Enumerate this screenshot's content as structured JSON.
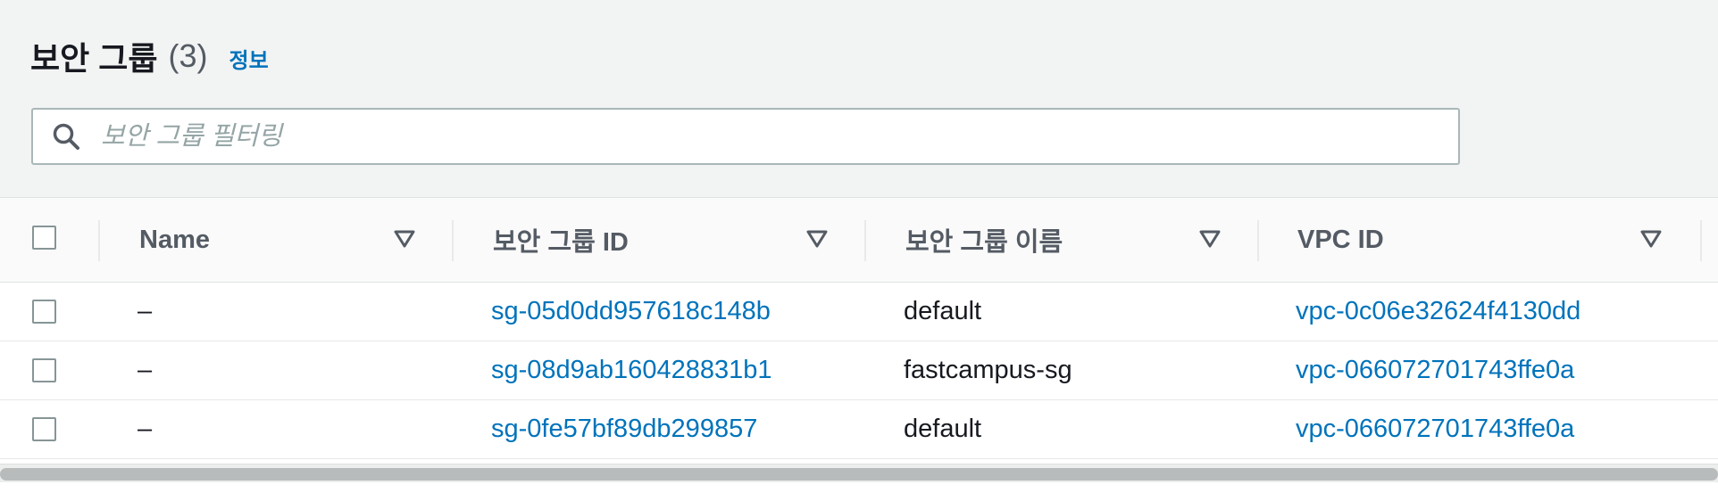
{
  "header": {
    "title": "보안 그룹",
    "count": "(3)",
    "info_link": "정보"
  },
  "search": {
    "placeholder": "보안 그룹 필터링",
    "value": ""
  },
  "table": {
    "columns": [
      {
        "label": "Name"
      },
      {
        "label": "보안 그룹 ID"
      },
      {
        "label": "보안 그룹 이름"
      },
      {
        "label": "VPC ID"
      }
    ],
    "rows": [
      {
        "name": "–",
        "sg_id": "sg-05d0dd957618c148b",
        "sg_name": "default",
        "vpc_id": "vpc-0c06e32624f4130dd"
      },
      {
        "name": "–",
        "sg_id": "sg-08d9ab160428831b1",
        "sg_name": "fastcampus-sg",
        "vpc_id": "vpc-066072701743ffe0a"
      },
      {
        "name": "–",
        "sg_id": "sg-0fe57bf89db299857",
        "sg_name": "default",
        "vpc_id": "vpc-066072701743ffe0a"
      }
    ]
  },
  "colors": {
    "link": "#0073bb",
    "text": "#16191f",
    "header_text": "#545b64",
    "page_bg": "#f2f3f3"
  },
  "icons": {
    "search": "search-icon",
    "sort": "sort-down-triangle-icon"
  }
}
